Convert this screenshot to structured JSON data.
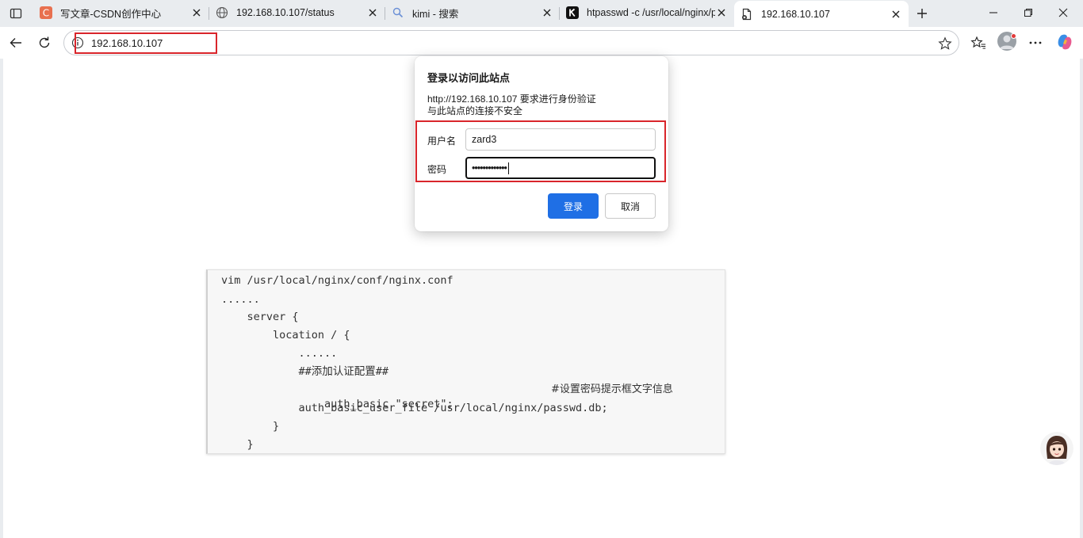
{
  "tabs": [
    {
      "title": "写文章-CSDN创作中心",
      "icon": "csdn-c-icon"
    },
    {
      "title": "192.168.10.107/status",
      "icon": "globe-icon"
    },
    {
      "title": "kimi - 搜索",
      "icon": "search-icon"
    },
    {
      "title": "htpasswd -c /usr/local/nginx/p",
      "icon": "kimi-k-icon"
    },
    {
      "title": "192.168.10.107",
      "icon": "document-icon",
      "active": true
    }
  ],
  "address_bar": {
    "url": "192.168.10.107"
  },
  "dialog": {
    "title": "登录以访问此站点",
    "message_line1": "http://192.168.10.107 要求进行身份验证",
    "message_line2": "与此站点的连接不安全",
    "username_label": "用户名",
    "username_value": "zard3",
    "password_label": "密码",
    "password_value": "•••••••••••••",
    "login_button": "登录",
    "cancel_button": "取消"
  },
  "code_block": {
    "lines": [
      "vim /usr/local/nginx/conf/nginx.conf",
      "......",
      "    server {",
      "        location / {",
      "            ......",
      "            ##添加认证配置##",
      "            auth_basic \"secret\";",
      "            auth_basic_user_file /usr/local/nginx/passwd.db;",
      "        }",
      "    }"
    ],
    "comment_line7": "#设置密码提示框文字信息"
  },
  "colors": {
    "accent": "#1f6fe5",
    "highlight_red": "#d9252b",
    "tabstrip_bg": "#e9ecef"
  }
}
